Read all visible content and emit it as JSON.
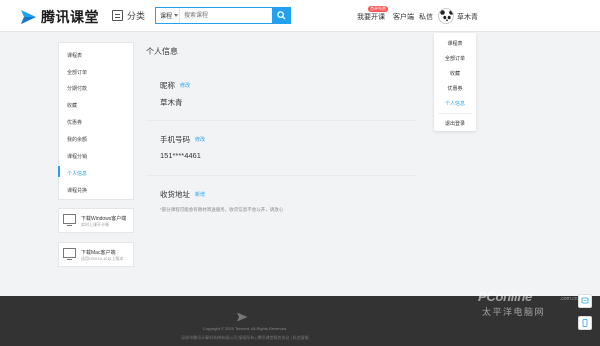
{
  "header": {
    "logo_text": "腾讯课堂",
    "category_label": "分类",
    "search_type": "课程",
    "search_placeholder": "搜索课程",
    "nav": {
      "apply_label": "我要开课",
      "apply_badge": "首单免费",
      "client_label": "客户端",
      "message_label": "私信",
      "username": "草木青"
    }
  },
  "user_menu": [
    {
      "label": "课程表"
    },
    {
      "label": "全部订单"
    },
    {
      "label": "收藏"
    },
    {
      "label": "优惠券"
    },
    {
      "label": "个人信息",
      "active": true
    },
    {
      "label": "退出登录"
    }
  ],
  "sidebar": {
    "items": [
      {
        "label": "课程表"
      },
      {
        "label": "全部订单"
      },
      {
        "label": "分期付款"
      },
      {
        "label": "收藏"
      },
      {
        "label": "优惠券"
      },
      {
        "label": "我的余额"
      },
      {
        "label": "课程分销"
      },
      {
        "label": "个人信息",
        "active": true
      },
      {
        "label": "课程兑换"
      }
    ],
    "downloads": [
      {
        "title": "下载Windows客户端",
        "subtitle": "实时上课不卡顿"
      },
      {
        "title": "下载Mac客户端",
        "subtitle": "适用OSX10.10以上版本"
      }
    ]
  },
  "main": {
    "title": "个人信息",
    "nickname": {
      "label": "昵称",
      "edit": "修改",
      "value": "草木青"
    },
    "phone": {
      "label": "手机号码",
      "edit": "修改",
      "value": "151****4461"
    },
    "address": {
      "label": "收货地址",
      "edit": "新增"
    },
    "note": "*部分课程可能会有教材寄送服务，收货信息不会公开，请放心"
  },
  "footer": {
    "copyright": "Copyright © 2020 Tencent. All Rights Reserved.",
    "links": "深圳市腾讯计算机系统有限公司 版权所有 | 腾讯课堂服务协议 | 私信客服"
  },
  "watermark": {
    "en": "PConline",
    "com": ".com.cn",
    "cn": "太平洋电脑网"
  },
  "colors": {
    "accent": "#23a1f0",
    "footer_bg": "#333333",
    "badge": "#ff4d4d"
  }
}
